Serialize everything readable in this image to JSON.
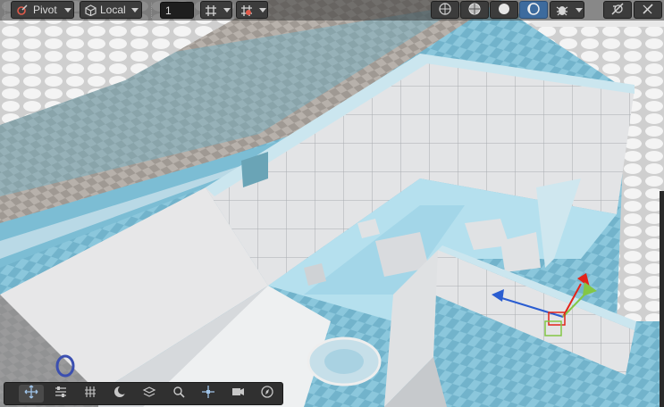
{
  "toolbar": {
    "pivot_label": "Pivot",
    "local_label": "Local",
    "grid_size_value": "1"
  },
  "icons": {
    "pivot": "pivot-icon",
    "local": "local-cube-icon",
    "grid_snap": "grid-snap-icon",
    "snap_increment": "snap-increment-icon",
    "shading_wireframe": "wireframe-sphere-icon",
    "shading_shaded_wire": "shaded-wireframe-sphere-icon",
    "shading_shaded": "shaded-sphere-icon",
    "shading_unlit": "unlit-sphere-icon",
    "gizmos": "gizmo-bug-icon",
    "visibility": "scene-visibility-off-icon",
    "tools": "tools-pick-icon"
  },
  "bottom_toolbar": [
    "move-tool-icon",
    "adjust-tool-icon",
    "grid-tool-icon",
    "moon-tool-icon",
    "layers-tool-icon",
    "search-tool-icon",
    "transform-tool-icon",
    "camera-tool-icon",
    "compass-tool-icon"
  ],
  "colors": {
    "toolbar_bg": "#383838",
    "active_button": "#3d6b9e",
    "gizmo_x": "#e2231a",
    "gizmo_y": "#83c745",
    "gizmo_z": "#2a5dd1",
    "floor": "#7fc1d8"
  }
}
